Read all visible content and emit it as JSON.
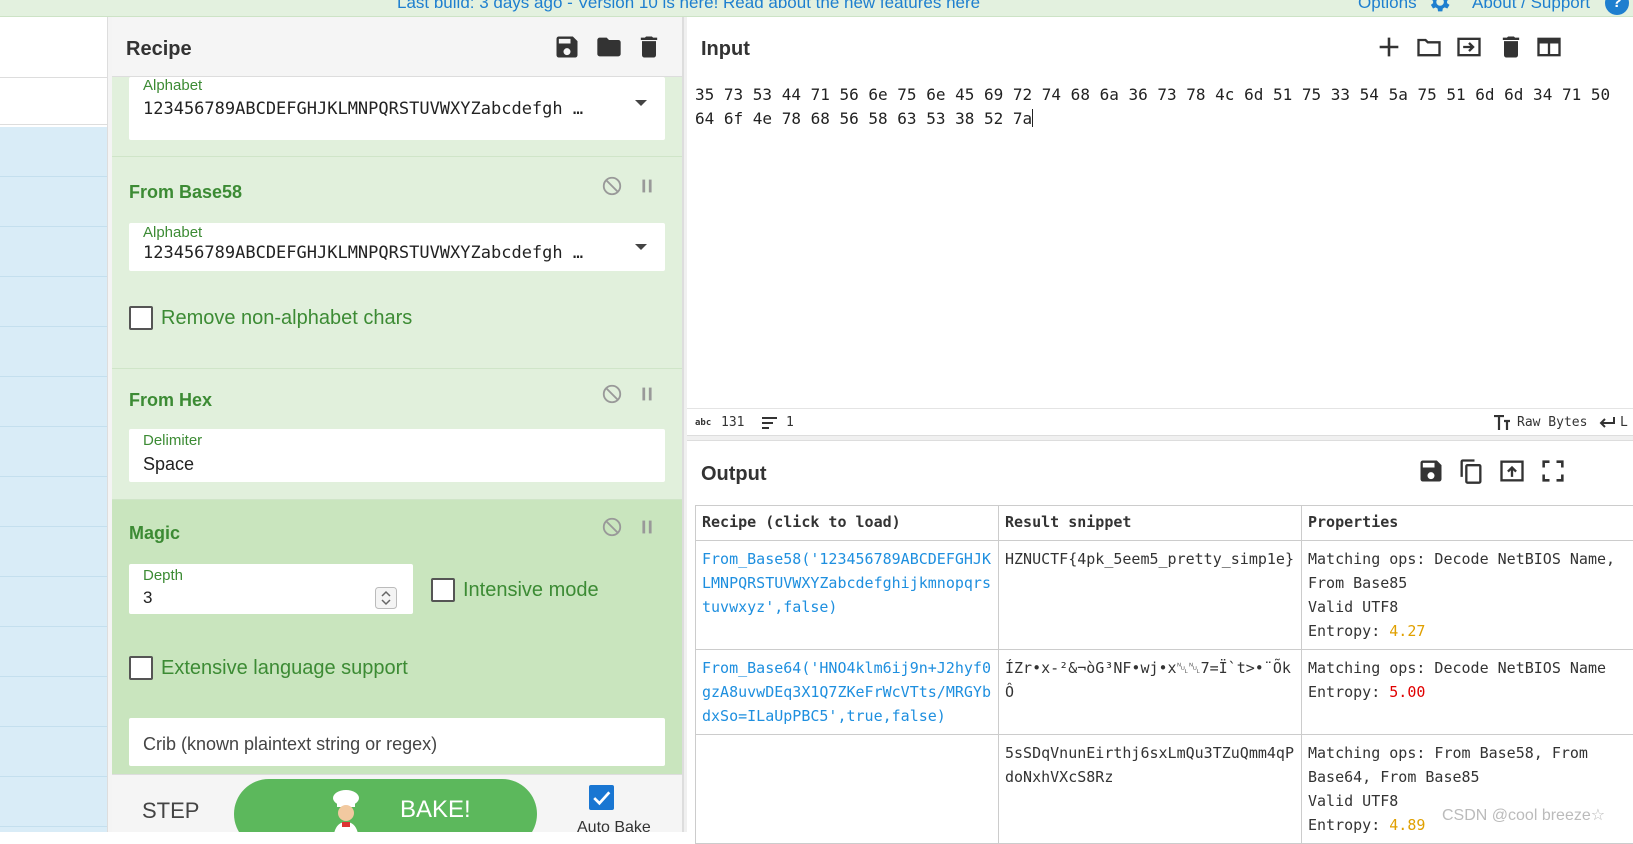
{
  "banner": {
    "message": "Last build: 3 days ago - Version 10 is here! Read about the new features here",
    "options": "Options",
    "about": "About / Support",
    "help": "?"
  },
  "recipe": {
    "title": "Recipe",
    "ops": [
      {
        "name": "",
        "field_label": "Alphabet",
        "field_value": "123456789ABCDEFGHJKLMNPQRSTUVWXYZabcdefgh …"
      },
      {
        "name": "From Base58",
        "field_label": "Alphabet",
        "field_value": "123456789ABCDEFGHJKLMNPQRSTUVWXYZabcdefgh …",
        "checkbox": "Remove non-alphabet chars"
      },
      {
        "name": "From Hex",
        "field_label": "Delimiter",
        "field_value": "Space"
      },
      {
        "name": "Magic",
        "depth_label": "Depth",
        "depth_value": "3",
        "intensive": "Intensive mode",
        "extensive": "Extensive language support",
        "crib_placeholder": "Crib (known plaintext string or regex)"
      }
    ],
    "controls": {
      "step": "STEP",
      "bake": "BAKE!",
      "auto_bake": "Auto Bake"
    }
  },
  "input": {
    "title": "Input",
    "text": "35 73 53 44 71 56 6e 75 6e 45 69 72 74 68 6a 36 73 78 4c 6d 51 75 33 54 5a 75 51 6d 6d 34 71 50\n64 6f 4e 78 68 56 58 63 53 38 52 7a",
    "status": {
      "chars_icon": "abc",
      "chars": "131",
      "lines": "1",
      "encoding": "Raw Bytes",
      "eol": "L"
    }
  },
  "output": {
    "title": "Output",
    "headers": [
      "Recipe (click to load)",
      "Result snippet",
      "Properties"
    ],
    "rows": [
      {
        "recipe": "From_Base58('123456789ABCDEFGHJKLMNPQRSTUVWXYZabcdefghijkmnopqrstuvwxyz',false)",
        "result": "HZNUCTF{4pk_5eem5_pretty_simp1e}",
        "properties": [
          "Matching ops: Decode NetBIOS Name, From Base85",
          "Valid UTF8"
        ],
        "entropy_label": "Entropy: ",
        "entropy": "4.27"
      },
      {
        "recipe": "From_Base64('HNO4klm6ij9n+J2hyf0gzA8uvwDEq3X1Q7ZKeFrWcVTts/MRGYbdxSo=ILaUpPBC5',true,false)",
        "result": "ÍZr•x-²&¬òG³NF•wj•x␀␀7=Ï`t>•¨ÕkÔ",
        "properties": [
          "Matching ops: Decode NetBIOS Name"
        ],
        "entropy_label": "Entropy: ",
        "entropy": "5.00"
      },
      {
        "recipe": "",
        "result": "5sSDqVnunEirthj6sxLmQu3TZuQmm4qPdoNxhVXcS8Rz",
        "properties": [
          "Matching ops: From Base58, From Base64, From Base85",
          "Valid UTF8"
        ],
        "entropy_label": "Entropy: ",
        "entropy": "4.89"
      }
    ]
  },
  "watermark": "CSDN @cool breeze☆",
  "colors": {
    "accent_green": "#3c8b34",
    "bake_green": "#5cb85c",
    "link_blue": "#1e8fdf",
    "ops_blue": "#d9ecf7"
  }
}
